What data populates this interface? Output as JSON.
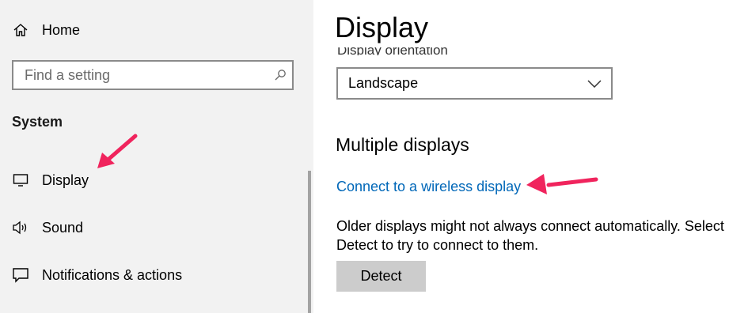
{
  "sidebar": {
    "home_label": "Home",
    "search": {
      "placeholder": "Find a setting",
      "value": ""
    },
    "section_title": "System",
    "items": [
      {
        "label": "Display",
        "icon": "monitor-icon"
      },
      {
        "label": "Sound",
        "icon": "speaker-icon"
      },
      {
        "label": "Notifications & actions",
        "icon": "message-icon"
      }
    ]
  },
  "main": {
    "title": "Display",
    "orientation": {
      "label": "Display orientation",
      "value": "Landscape"
    },
    "multiple_displays": {
      "heading": "Multiple displays",
      "wireless_link": "Connect to a wireless display",
      "desc_line1": "Older displays might not always connect automatically. Select",
      "desc_line2": "Detect to try to connect to them.",
      "detect_button": "Detect"
    }
  },
  "colors": {
    "link": "#0067b8",
    "annotation_arrow": "#f0245d",
    "sidebar_bg": "#f2f2f2"
  }
}
